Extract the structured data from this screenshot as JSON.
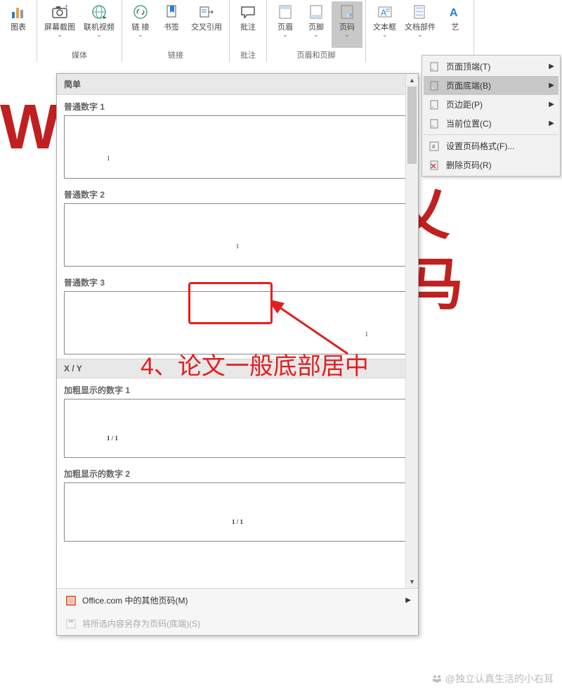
{
  "ribbon": {
    "groups": [
      {
        "label": "",
        "buttons": [
          {
            "label": "图表",
            "icon": "chart"
          }
        ]
      },
      {
        "label": "媒体",
        "buttons": [
          {
            "label": "屏幕截图",
            "icon": "camera",
            "dropdown": true
          },
          {
            "label": "联机视频",
            "icon": "globe",
            "dropdown": true
          }
        ]
      },
      {
        "label": "链接",
        "buttons": [
          {
            "label": "链\n接",
            "icon": "link",
            "dropdown": true
          },
          {
            "label": "书签",
            "icon": "bookmark"
          },
          {
            "label": "交叉引用",
            "icon": "crossref"
          }
        ]
      },
      {
        "label": "批注",
        "buttons": [
          {
            "label": "批注",
            "icon": "comment"
          }
        ]
      },
      {
        "label": "页眉和页脚",
        "buttons": [
          {
            "label": "页眉",
            "icon": "header",
            "dropdown": true
          },
          {
            "label": "页脚",
            "icon": "footer",
            "dropdown": true
          },
          {
            "label": "页码",
            "icon": "pagenum",
            "dropdown": true,
            "highlighted": true
          }
        ]
      },
      {
        "label": "",
        "buttons": [
          {
            "label": "文本框",
            "icon": "textbox",
            "dropdown": true
          },
          {
            "label": "文档部件",
            "icon": "parts",
            "dropdown": true
          },
          {
            "label": "艺",
            "icon": "wordart"
          }
        ]
      }
    ]
  },
  "dropdown": {
    "items": [
      {
        "label": "页面顶端(T)",
        "submenu": true
      },
      {
        "label": "页面底端(B)",
        "submenu": true,
        "hover": true
      },
      {
        "label": "页边距(P)",
        "submenu": true
      },
      {
        "label": "当前位置(C)",
        "submenu": true
      },
      {
        "sep": true
      },
      {
        "label": "设置页码格式(F)..."
      },
      {
        "label": "删除页码(R)"
      }
    ]
  },
  "gallery": {
    "sections": [
      {
        "header": "简单",
        "items": [
          {
            "label": "普通数字 1",
            "align": "left",
            "text": "1"
          },
          {
            "label": "普通数字 2",
            "align": "center",
            "text": "1"
          },
          {
            "label": "普通数字 3",
            "align": "right",
            "text": "1"
          }
        ]
      },
      {
        "header": "X / Y",
        "items": [
          {
            "label": "加粗显示的数字 1",
            "align": "left",
            "text": "1 / 1",
            "bold": true
          },
          {
            "label": "加粗显示的数字 2",
            "align": "center",
            "text": "1 / 1",
            "bold": true
          }
        ]
      }
    ],
    "footer": {
      "more": "Office.com 中的其他页码(M)",
      "save": "将所选内容另存为页码(底端)(S)"
    }
  },
  "annotation": {
    "text": "4、论文一般底部居中"
  },
  "watermark": "@独立认真生活的小右耳",
  "behind": {
    "wo": "Wo",
    "c1": "乂",
    "c2": "马"
  }
}
